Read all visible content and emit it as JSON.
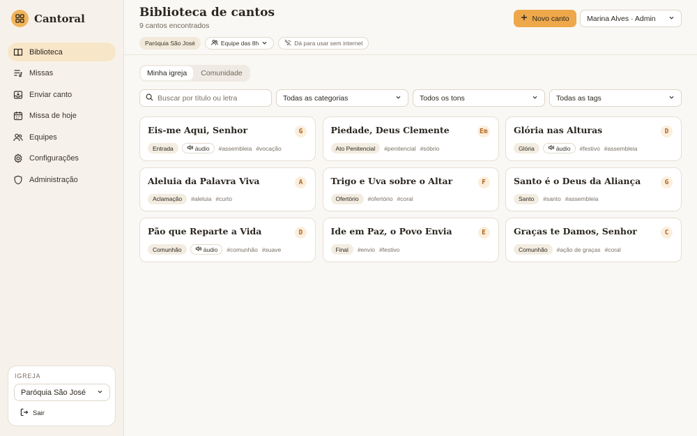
{
  "brand": {
    "name": "Cantoral"
  },
  "sidebar": {
    "items": [
      {
        "label": "Biblioteca",
        "icon": "book-icon"
      },
      {
        "label": "Missas",
        "icon": "list-music-icon"
      },
      {
        "label": "Enviar canto",
        "icon": "inbox-upload-icon"
      },
      {
        "label": "Missa de hoje",
        "icon": "calendar-icon"
      },
      {
        "label": "Equipes",
        "icon": "users-icon"
      },
      {
        "label": "Configurações",
        "icon": "gear-icon"
      },
      {
        "label": "Administração",
        "icon": "shield-icon"
      }
    ],
    "church_label": "IGREJA",
    "church_value": "Paróquia São José",
    "logout_label": "Sair"
  },
  "header": {
    "title": "Biblioteca de cantos",
    "subtitle": "9 cantos encontrados",
    "chips": {
      "parish": "Paróquia São José",
      "team": "Equipe das 8h",
      "offline": "Dá para usar sem internet"
    },
    "new_button": "Novo canto",
    "user": "Marina Alves · Admin"
  },
  "tabs": [
    "Minha igreja",
    "Comunidade"
  ],
  "search": {
    "placeholder": "Buscar por título ou letra"
  },
  "filters": {
    "category": "Todas as categorias",
    "key": "Todos os tons",
    "tags": "Todas as tags"
  },
  "audio_label": "áudio",
  "songs": [
    {
      "title": "Eis-me Aqui, Senhor",
      "key": "G",
      "category": "Entrada",
      "audio": true,
      "tags": [
        "#assembleia",
        "#vocação"
      ]
    },
    {
      "title": "Piedade, Deus Clemente",
      "key": "Em",
      "category": "Ato Penitencial",
      "audio": false,
      "tags": [
        "#penitencial",
        "#sóbrio"
      ]
    },
    {
      "title": "Glória nas Alturas",
      "key": "D",
      "category": "Glória",
      "audio": true,
      "tags": [
        "#festivo",
        "#assembleia"
      ]
    },
    {
      "title": "Aleluia da Palavra Viva",
      "key": "A",
      "category": "Aclamação",
      "audio": false,
      "tags": [
        "#aleluia",
        "#curto"
      ]
    },
    {
      "title": "Trigo e Uva sobre o Altar",
      "key": "F",
      "category": "Ofertório",
      "audio": false,
      "tags": [
        "#ofertório",
        "#coral"
      ]
    },
    {
      "title": "Santo é o Deus da Aliança",
      "key": "G",
      "category": "Santo",
      "audio": false,
      "tags": [
        "#santo",
        "#assembleia"
      ]
    },
    {
      "title": "Pão que Reparte a Vida",
      "key": "D",
      "category": "Comunhão",
      "audio": true,
      "tags": [
        "#comunhão",
        "#suave"
      ]
    },
    {
      "title": "Ide em Paz, o Povo Envia",
      "key": "E",
      "category": "Final",
      "audio": false,
      "tags": [
        "#envio",
        "#festivo"
      ]
    },
    {
      "title": "Graças te Damos, Senhor",
      "key": "C",
      "category": "Comunhão",
      "audio": false,
      "tags": [
        "#ação de graças",
        "#coral"
      ]
    }
  ],
  "colors": {
    "accent": "#eea84a",
    "active_nav": "#f8e6c8",
    "key_text": "#b0641c"
  }
}
